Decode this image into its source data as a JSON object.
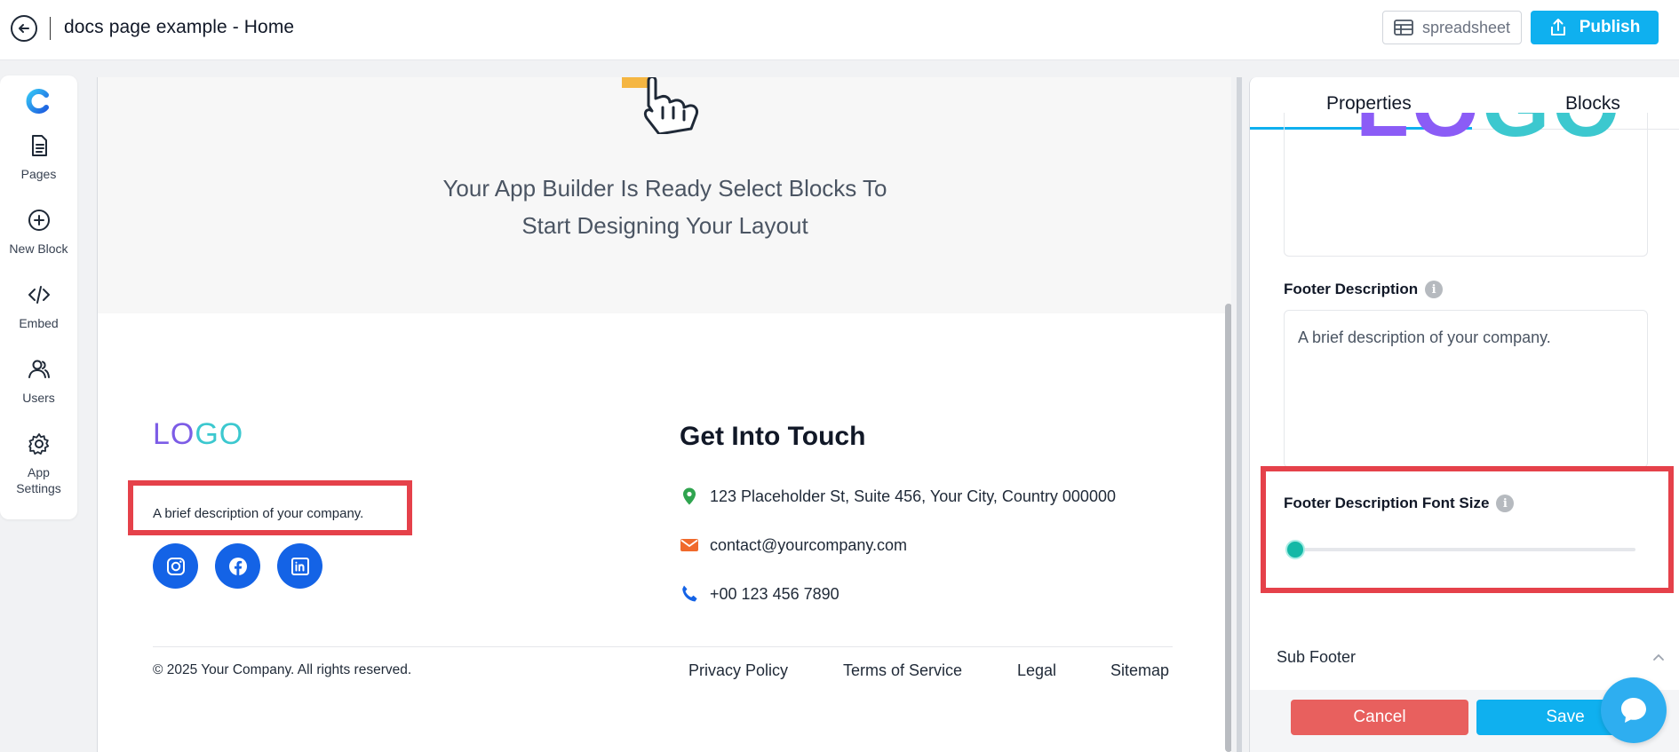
{
  "topbar": {
    "title": "docs page example - Home",
    "spreadsheet_label": "spreadsheet",
    "publish_label": "Publish"
  },
  "sidebar": {
    "items": [
      {
        "label": "Pages",
        "icon": "document-icon"
      },
      {
        "label": "New Block",
        "icon": "plus-circle-icon"
      },
      {
        "label": "Embed",
        "icon": "code-icon"
      },
      {
        "label": "Users",
        "icon": "users-icon"
      },
      {
        "label": "App Settings",
        "icon": "gear-icon"
      }
    ]
  },
  "canvas": {
    "hero_line1": "Your App Builder Is Ready Select Blocks To",
    "hero_line2": "Start Designing Your Layout",
    "logo_part1": "LO",
    "logo_part2": "GO",
    "description": "A brief description of your company.",
    "touch_title": "Get Into Touch",
    "address": "123 Placeholder St, Suite 456, Your City, Country 000000",
    "email": "contact@yourcompany.com",
    "phone": "+00 123 456 7890",
    "copyright": "© 2025 Your Company. All rights reserved.",
    "links": [
      "Privacy Policy",
      "Terms of Service",
      "Legal",
      "Sitemap"
    ]
  },
  "panel": {
    "tabs": [
      "Properties",
      "Blocks"
    ],
    "active_tab": "Properties",
    "logo_preview_part1": "LO",
    "logo_preview_part2": "GO",
    "footer_description_label": "Footer Description",
    "footer_description_value": "A brief description of your company.",
    "font_size_label": "Footer Description Font Size",
    "font_size_slider_fraction": 0.0,
    "sub_footer_label": "Sub Footer",
    "cancel_label": "Cancel",
    "save_label": "Save"
  },
  "colors": {
    "accent": "#0fb0ef",
    "highlight": "#e5414a",
    "social": "#1463e6",
    "logo_purple": "#7c5ce6",
    "logo_teal": "#3cc8cf",
    "slider": "#14b8a6",
    "cancel": "#e8605e"
  }
}
